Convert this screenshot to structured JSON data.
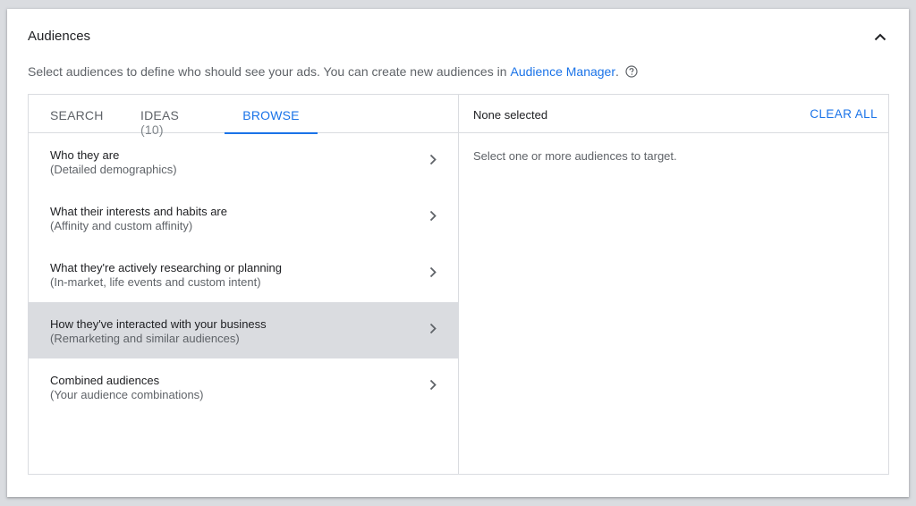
{
  "section": {
    "title": "Audiences",
    "subtitle_text": "Select audiences to define who should see your ads. You can create new audiences in",
    "subtitle_link": "Audience Manager",
    "subtitle_end": "."
  },
  "tabs": [
    {
      "label": "SEARCH"
    },
    {
      "label": "IDEAS",
      "count": "(10)"
    },
    {
      "label": "BROWSE",
      "active": true
    }
  ],
  "browse_items": [
    {
      "title": "Who they are",
      "subtitle": "(Detailed demographics)"
    },
    {
      "title": "What their interests and habits are",
      "subtitle": "(Affinity and custom affinity)"
    },
    {
      "title": "What they're actively researching or planning",
      "subtitle": "(In-market, life events and custom intent)"
    },
    {
      "title": "How they've interacted with your business",
      "subtitle": "(Remarketing and similar audiences)",
      "active": true
    },
    {
      "title": "Combined audiences",
      "subtitle": "(Your audience combinations)"
    }
  ],
  "selection": {
    "status": "None selected",
    "clear_label": "CLEAR ALL",
    "hint": "Select one or more audiences to target."
  },
  "colors": {
    "accent": "#1a73e8",
    "active_row": "#dadce0",
    "border": "#dadce0"
  },
  "icons": {
    "collapse": "chevron-up-icon",
    "help": "help-circle-icon",
    "row": "chevron-right-icon"
  }
}
